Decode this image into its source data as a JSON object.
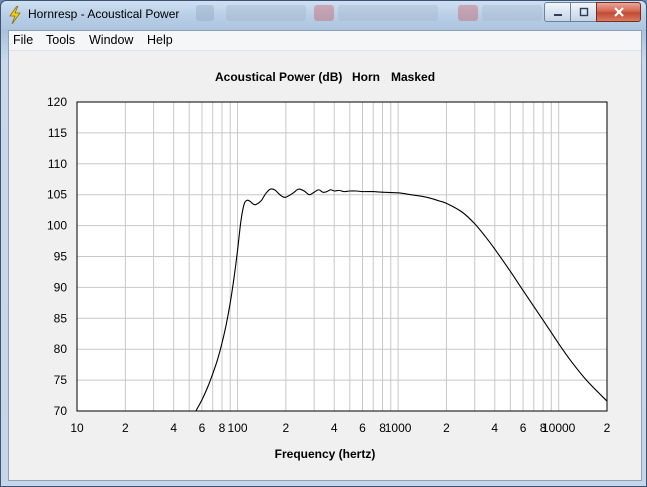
{
  "window": {
    "title": "Hornresp - Acoustical Power",
    "icon": "lightning-bolt-icon",
    "buttons": {
      "minimize": "minimize-icon",
      "maximize": "maximize-icon",
      "close": "close-icon"
    }
  },
  "menu": {
    "items": [
      "File",
      "Tools",
      "Window",
      "Help"
    ]
  },
  "colors": {
    "plot_background": "#ffffff",
    "curve": "#000000",
    "grid": "#c8c8c8",
    "client_background": "#f0f0f0"
  },
  "chart_data": {
    "type": "line",
    "title": "Acoustical Power (dB)",
    "subtitle_parts": [
      "Horn",
      "Masked"
    ],
    "xlabel": "Frequency (hertz)",
    "ylabel": "",
    "x_scale": "log",
    "xlim": [
      10,
      20000
    ],
    "ylim": [
      70,
      120
    ],
    "grid": true,
    "legend": "none",
    "y_ticks": [
      "120",
      "115",
      "110",
      "105",
      "100",
      "95",
      "90",
      "85",
      "80",
      "75",
      "70"
    ],
    "x_tick_labels": [
      {
        "value": 10,
        "label": "10"
      },
      {
        "value": 20,
        "label": "2"
      },
      {
        "value": 40,
        "label": "4"
      },
      {
        "value": 60,
        "label": "6"
      },
      {
        "value": 80,
        "label": "8"
      },
      {
        "value": 100,
        "label": "100"
      },
      {
        "value": 200,
        "label": "2"
      },
      {
        "value": 400,
        "label": "4"
      },
      {
        "value": 600,
        "label": "6"
      },
      {
        "value": 800,
        "label": "8"
      },
      {
        "value": 1000,
        "label": "1000"
      },
      {
        "value": 2000,
        "label": "2"
      },
      {
        "value": 4000,
        "label": "4"
      },
      {
        "value": 6000,
        "label": "6"
      },
      {
        "value": 8000,
        "label": "8"
      },
      {
        "value": 10000,
        "label": "10000"
      },
      {
        "value": 20000,
        "label": "2"
      }
    ],
    "series": [
      {
        "x": [
          55,
          60,
          65,
          70,
          75,
          80,
          85,
          90,
          95,
          100,
          105,
          110,
          115,
          120,
          125,
          130,
          140,
          150,
          160,
          170,
          180,
          190,
          200,
          220,
          240,
          260,
          280,
          300,
          320,
          340,
          360,
          380,
          400,
          430,
          460,
          500,
          550,
          600,
          700,
          800,
          1000,
          1200,
          1500,
          1800,
          2000,
          2500,
          3000,
          3500,
          4000,
          5000,
          6000,
          8000,
          10000,
          12000,
          15000,
          20000
        ],
        "y": [
          70,
          71.8,
          73.8,
          76.0,
          78.3,
          81.0,
          84.0,
          87.5,
          91.5,
          96.0,
          100.8,
          103.5,
          104.1,
          103.9,
          103.5,
          103.4,
          104.0,
          105.2,
          105.9,
          105.8,
          105.2,
          104.7,
          104.6,
          105.2,
          105.9,
          105.6,
          105.0,
          105.4,
          105.8,
          105.4,
          105.5,
          105.8,
          105.6,
          105.7,
          105.5,
          105.6,
          105.6,
          105.5,
          105.5,
          105.4,
          105.3,
          105.0,
          104.6,
          104.0,
          103.6,
          102.2,
          100.3,
          98.2,
          96.2,
          92.6,
          89.5,
          84.7,
          80.9,
          78.0,
          74.9,
          71.6
        ]
      }
    ]
  }
}
